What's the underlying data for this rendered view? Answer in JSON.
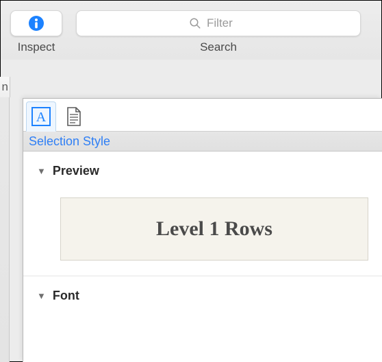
{
  "toolbar": {
    "inspect_label": "Inspect",
    "search_label": "Search",
    "search_placeholder": "Filter",
    "left_tab_fragment": "n"
  },
  "inspector": {
    "tab_caption": "Selection Style",
    "sections": {
      "preview_label": "Preview",
      "font_label": "Font"
    },
    "preview_text": "Level 1 Rows"
  },
  "icons": {
    "info": "info-icon",
    "magnifier": "search-icon",
    "letter_a": "selection-style-icon",
    "document": "document-icon",
    "disclosure": "disclosure-triangle-icon"
  }
}
